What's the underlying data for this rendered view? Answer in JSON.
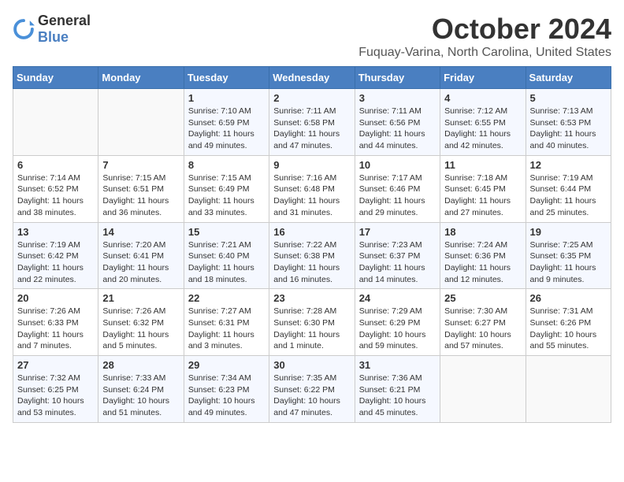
{
  "header": {
    "logo_general": "General",
    "logo_blue": "Blue",
    "month": "October 2024",
    "location": "Fuquay-Varina, North Carolina, United States"
  },
  "weekdays": [
    "Sunday",
    "Monday",
    "Tuesday",
    "Wednesday",
    "Thursday",
    "Friday",
    "Saturday"
  ],
  "weeks": [
    [
      {
        "day": "",
        "sunrise": "",
        "sunset": "",
        "daylight": ""
      },
      {
        "day": "",
        "sunrise": "",
        "sunset": "",
        "daylight": ""
      },
      {
        "day": "1",
        "sunrise": "Sunrise: 7:10 AM",
        "sunset": "Sunset: 6:59 PM",
        "daylight": "Daylight: 11 hours and 49 minutes."
      },
      {
        "day": "2",
        "sunrise": "Sunrise: 7:11 AM",
        "sunset": "Sunset: 6:58 PM",
        "daylight": "Daylight: 11 hours and 47 minutes."
      },
      {
        "day": "3",
        "sunrise": "Sunrise: 7:11 AM",
        "sunset": "Sunset: 6:56 PM",
        "daylight": "Daylight: 11 hours and 44 minutes."
      },
      {
        "day": "4",
        "sunrise": "Sunrise: 7:12 AM",
        "sunset": "Sunset: 6:55 PM",
        "daylight": "Daylight: 11 hours and 42 minutes."
      },
      {
        "day": "5",
        "sunrise": "Sunrise: 7:13 AM",
        "sunset": "Sunset: 6:53 PM",
        "daylight": "Daylight: 11 hours and 40 minutes."
      }
    ],
    [
      {
        "day": "6",
        "sunrise": "Sunrise: 7:14 AM",
        "sunset": "Sunset: 6:52 PM",
        "daylight": "Daylight: 11 hours and 38 minutes."
      },
      {
        "day": "7",
        "sunrise": "Sunrise: 7:15 AM",
        "sunset": "Sunset: 6:51 PM",
        "daylight": "Daylight: 11 hours and 36 minutes."
      },
      {
        "day": "8",
        "sunrise": "Sunrise: 7:15 AM",
        "sunset": "Sunset: 6:49 PM",
        "daylight": "Daylight: 11 hours and 33 minutes."
      },
      {
        "day": "9",
        "sunrise": "Sunrise: 7:16 AM",
        "sunset": "Sunset: 6:48 PM",
        "daylight": "Daylight: 11 hours and 31 minutes."
      },
      {
        "day": "10",
        "sunrise": "Sunrise: 7:17 AM",
        "sunset": "Sunset: 6:46 PM",
        "daylight": "Daylight: 11 hours and 29 minutes."
      },
      {
        "day": "11",
        "sunrise": "Sunrise: 7:18 AM",
        "sunset": "Sunset: 6:45 PM",
        "daylight": "Daylight: 11 hours and 27 minutes."
      },
      {
        "day": "12",
        "sunrise": "Sunrise: 7:19 AM",
        "sunset": "Sunset: 6:44 PM",
        "daylight": "Daylight: 11 hours and 25 minutes."
      }
    ],
    [
      {
        "day": "13",
        "sunrise": "Sunrise: 7:19 AM",
        "sunset": "Sunset: 6:42 PM",
        "daylight": "Daylight: 11 hours and 22 minutes."
      },
      {
        "day": "14",
        "sunrise": "Sunrise: 7:20 AM",
        "sunset": "Sunset: 6:41 PM",
        "daylight": "Daylight: 11 hours and 20 minutes."
      },
      {
        "day": "15",
        "sunrise": "Sunrise: 7:21 AM",
        "sunset": "Sunset: 6:40 PM",
        "daylight": "Daylight: 11 hours and 18 minutes."
      },
      {
        "day": "16",
        "sunrise": "Sunrise: 7:22 AM",
        "sunset": "Sunset: 6:38 PM",
        "daylight": "Daylight: 11 hours and 16 minutes."
      },
      {
        "day": "17",
        "sunrise": "Sunrise: 7:23 AM",
        "sunset": "Sunset: 6:37 PM",
        "daylight": "Daylight: 11 hours and 14 minutes."
      },
      {
        "day": "18",
        "sunrise": "Sunrise: 7:24 AM",
        "sunset": "Sunset: 6:36 PM",
        "daylight": "Daylight: 11 hours and 12 minutes."
      },
      {
        "day": "19",
        "sunrise": "Sunrise: 7:25 AM",
        "sunset": "Sunset: 6:35 PM",
        "daylight": "Daylight: 11 hours and 9 minutes."
      }
    ],
    [
      {
        "day": "20",
        "sunrise": "Sunrise: 7:26 AM",
        "sunset": "Sunset: 6:33 PM",
        "daylight": "Daylight: 11 hours and 7 minutes."
      },
      {
        "day": "21",
        "sunrise": "Sunrise: 7:26 AM",
        "sunset": "Sunset: 6:32 PM",
        "daylight": "Daylight: 11 hours and 5 minutes."
      },
      {
        "day": "22",
        "sunrise": "Sunrise: 7:27 AM",
        "sunset": "Sunset: 6:31 PM",
        "daylight": "Daylight: 11 hours and 3 minutes."
      },
      {
        "day": "23",
        "sunrise": "Sunrise: 7:28 AM",
        "sunset": "Sunset: 6:30 PM",
        "daylight": "Daylight: 11 hours and 1 minute."
      },
      {
        "day": "24",
        "sunrise": "Sunrise: 7:29 AM",
        "sunset": "Sunset: 6:29 PM",
        "daylight": "Daylight: 10 hours and 59 minutes."
      },
      {
        "day": "25",
        "sunrise": "Sunrise: 7:30 AM",
        "sunset": "Sunset: 6:27 PM",
        "daylight": "Daylight: 10 hours and 57 minutes."
      },
      {
        "day": "26",
        "sunrise": "Sunrise: 7:31 AM",
        "sunset": "Sunset: 6:26 PM",
        "daylight": "Daylight: 10 hours and 55 minutes."
      }
    ],
    [
      {
        "day": "27",
        "sunrise": "Sunrise: 7:32 AM",
        "sunset": "Sunset: 6:25 PM",
        "daylight": "Daylight: 10 hours and 53 minutes."
      },
      {
        "day": "28",
        "sunrise": "Sunrise: 7:33 AM",
        "sunset": "Sunset: 6:24 PM",
        "daylight": "Daylight: 10 hours and 51 minutes."
      },
      {
        "day": "29",
        "sunrise": "Sunrise: 7:34 AM",
        "sunset": "Sunset: 6:23 PM",
        "daylight": "Daylight: 10 hours and 49 minutes."
      },
      {
        "day": "30",
        "sunrise": "Sunrise: 7:35 AM",
        "sunset": "Sunset: 6:22 PM",
        "daylight": "Daylight: 10 hours and 47 minutes."
      },
      {
        "day": "31",
        "sunrise": "Sunrise: 7:36 AM",
        "sunset": "Sunset: 6:21 PM",
        "daylight": "Daylight: 10 hours and 45 minutes."
      },
      {
        "day": "",
        "sunrise": "",
        "sunset": "",
        "daylight": ""
      },
      {
        "day": "",
        "sunrise": "",
        "sunset": "",
        "daylight": ""
      }
    ]
  ]
}
